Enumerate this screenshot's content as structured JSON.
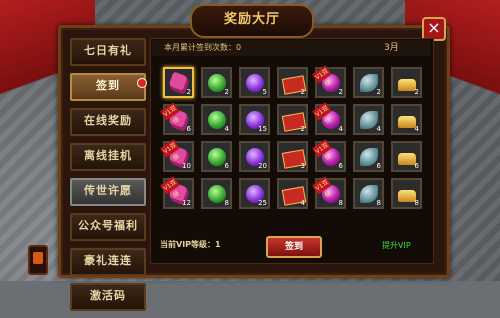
{
  "title": "奖励大厅",
  "menu": [
    {
      "label": "七日有礼"
    },
    {
      "label": "签到"
    },
    {
      "label": "在线奖励"
    },
    {
      "label": "离线挂机"
    },
    {
      "label": "传世许愿"
    },
    {
      "label": "公众号福利"
    },
    {
      "label": "豪礼连连"
    },
    {
      "label": "激活码"
    }
  ],
  "header": {
    "count_label": "本月累计签到次数：0",
    "month": "3月"
  },
  "grid": [
    [
      {
        "icon": "pink-crystal-icon",
        "qty": "2",
        "vip": ""
      },
      {
        "icon": "green-gem-icon",
        "qty": "2",
        "vip": ""
      },
      {
        "icon": "purple-orb-icon",
        "qty": "5",
        "vip": ""
      },
      {
        "icon": "red-book-icon",
        "qty": "2",
        "vip": ""
      },
      {
        "icon": "magenta-orb-icon",
        "qty": "2",
        "vip": "V1双倍"
      },
      {
        "icon": "jade-token-icon",
        "qty": "2",
        "vip": ""
      },
      {
        "icon": "gold-ingot-icon",
        "qty": "2",
        "vip": ""
      }
    ],
    [
      {
        "icon": "pink-crystal-icon",
        "qty": "6",
        "vip": "V1双倍"
      },
      {
        "icon": "green-gem-icon",
        "qty": "4",
        "vip": ""
      },
      {
        "icon": "purple-orb-icon",
        "qty": "15",
        "vip": ""
      },
      {
        "icon": "red-book-icon",
        "qty": "2",
        "vip": ""
      },
      {
        "icon": "magenta-orb-icon",
        "qty": "4",
        "vip": "V1双倍"
      },
      {
        "icon": "jade-token-icon",
        "qty": "4",
        "vip": ""
      },
      {
        "icon": "gold-ingot-icon",
        "qty": "4",
        "vip": ""
      }
    ],
    [
      {
        "icon": "pink-crystal-icon",
        "qty": "10",
        "vip": "V1双倍"
      },
      {
        "icon": "green-gem-icon",
        "qty": "6",
        "vip": ""
      },
      {
        "icon": "purple-orb-icon",
        "qty": "20",
        "vip": ""
      },
      {
        "icon": "red-book-icon",
        "qty": "3",
        "vip": ""
      },
      {
        "icon": "magenta-orb-icon",
        "qty": "6",
        "vip": "V1双倍"
      },
      {
        "icon": "jade-token-icon",
        "qty": "6",
        "vip": ""
      },
      {
        "icon": "gold-ingot-icon",
        "qty": "6",
        "vip": ""
      }
    ],
    [
      {
        "icon": "pink-crystal-icon",
        "qty": "12",
        "vip": "V1双倍"
      },
      {
        "icon": "green-gem-icon",
        "qty": "8",
        "vip": ""
      },
      {
        "icon": "purple-orb-icon",
        "qty": "25",
        "vip": ""
      },
      {
        "icon": "red-book-icon",
        "qty": "4",
        "vip": ""
      },
      {
        "icon": "magenta-orb-icon",
        "qty": "8",
        "vip": "V1双倍"
      },
      {
        "icon": "jade-token-icon",
        "qty": "8",
        "vip": ""
      },
      {
        "icon": "gold-ingot-icon",
        "qty": "8",
        "vip": ""
      }
    ]
  ],
  "footer": {
    "vip_level": "当前VIP等级：1",
    "sign_button": "签到",
    "upgrade_vip": "提升VIP"
  },
  "close_label": "×"
}
